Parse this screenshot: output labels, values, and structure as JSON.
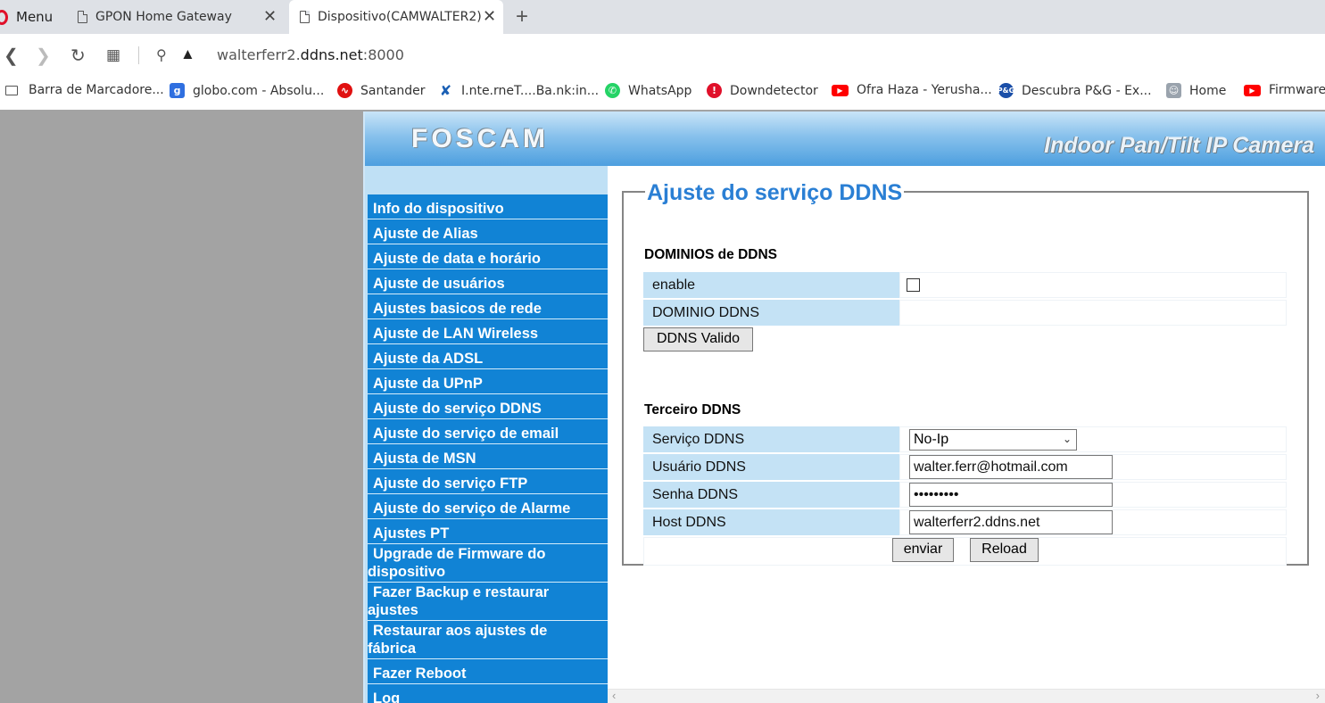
{
  "browser": {
    "menu_label": "Menu",
    "tabs": [
      {
        "title": "GPON Home Gateway"
      },
      {
        "title": "Dispositivo(CAMWALTER2)"
      }
    ],
    "url_host_prefix": "walterferr2.",
    "url_host_main": "ddns.net",
    "url_port": ":8000",
    "bookmarks": [
      {
        "label": "Barra de Marcadore..."
      },
      {
        "label": "globo.com - Absolu..."
      },
      {
        "label": "Santander"
      },
      {
        "label": "I.nte.rneT....Ba.nk:in..."
      },
      {
        "label": "WhatsApp"
      },
      {
        "label": "Downdetector"
      },
      {
        "label": "Ofra Haza - Yerusha..."
      },
      {
        "label": "Descubra P&G - Ex..."
      },
      {
        "label": "Home"
      },
      {
        "label": "Firmware"
      }
    ]
  },
  "banner": {
    "logo": "FOSCAM",
    "product": "Indoor Pan/Tilt IP Camera"
  },
  "sidebar": {
    "items": [
      {
        "label": "Info do dispositivo"
      },
      {
        "label": "Ajuste de Alias"
      },
      {
        "label": "Ajuste de data e horário"
      },
      {
        "label": "Ajuste de usuários"
      },
      {
        "label": "Ajustes basicos de rede"
      },
      {
        "label": "Ajuste de LAN Wireless"
      },
      {
        "label": "Ajuste da ADSL"
      },
      {
        "label": "Ajuste da UPnP"
      },
      {
        "label": "Ajuste do serviço DDNS"
      },
      {
        "label": "Ajuste do serviço de email"
      },
      {
        "label": "Ajusta de MSN"
      },
      {
        "label": "Ajuste do serviço FTP"
      },
      {
        "label": "Ajuste do serviço de Alarme"
      },
      {
        "label": "Ajustes PT"
      },
      {
        "line1": "Upgrade de Firmware do",
        "line2": "dispositivo"
      },
      {
        "line1": "Fazer Backup e restaurar",
        "line2": "ajustes"
      },
      {
        "line1": "Restaurar aos ajustes de",
        "line2": "fábrica"
      },
      {
        "label": "Fazer Reboot"
      },
      {
        "label": "Log"
      }
    ]
  },
  "ddns": {
    "title": "Ajuste do serviço DDNS",
    "section1": {
      "heading": "DOMINIOS de DDNS",
      "enable_label": "enable",
      "domain_label": "DOMINIO DDNS",
      "valid_button": "DDNS Valido"
    },
    "section2": {
      "heading": "Terceiro DDNS",
      "service_label": "Serviço DDNS",
      "service_value": "No-Ip",
      "user_label": "Usuário DDNS",
      "user_value": "walter.ferr@hotmail.com",
      "password_label": "Senha DDNS",
      "password_value": "•••••••••",
      "host_label": "Host DDNS",
      "host_value": "walterferr2.ddns.net",
      "submit_button": "enviar",
      "reload_button": "Reload"
    }
  }
}
